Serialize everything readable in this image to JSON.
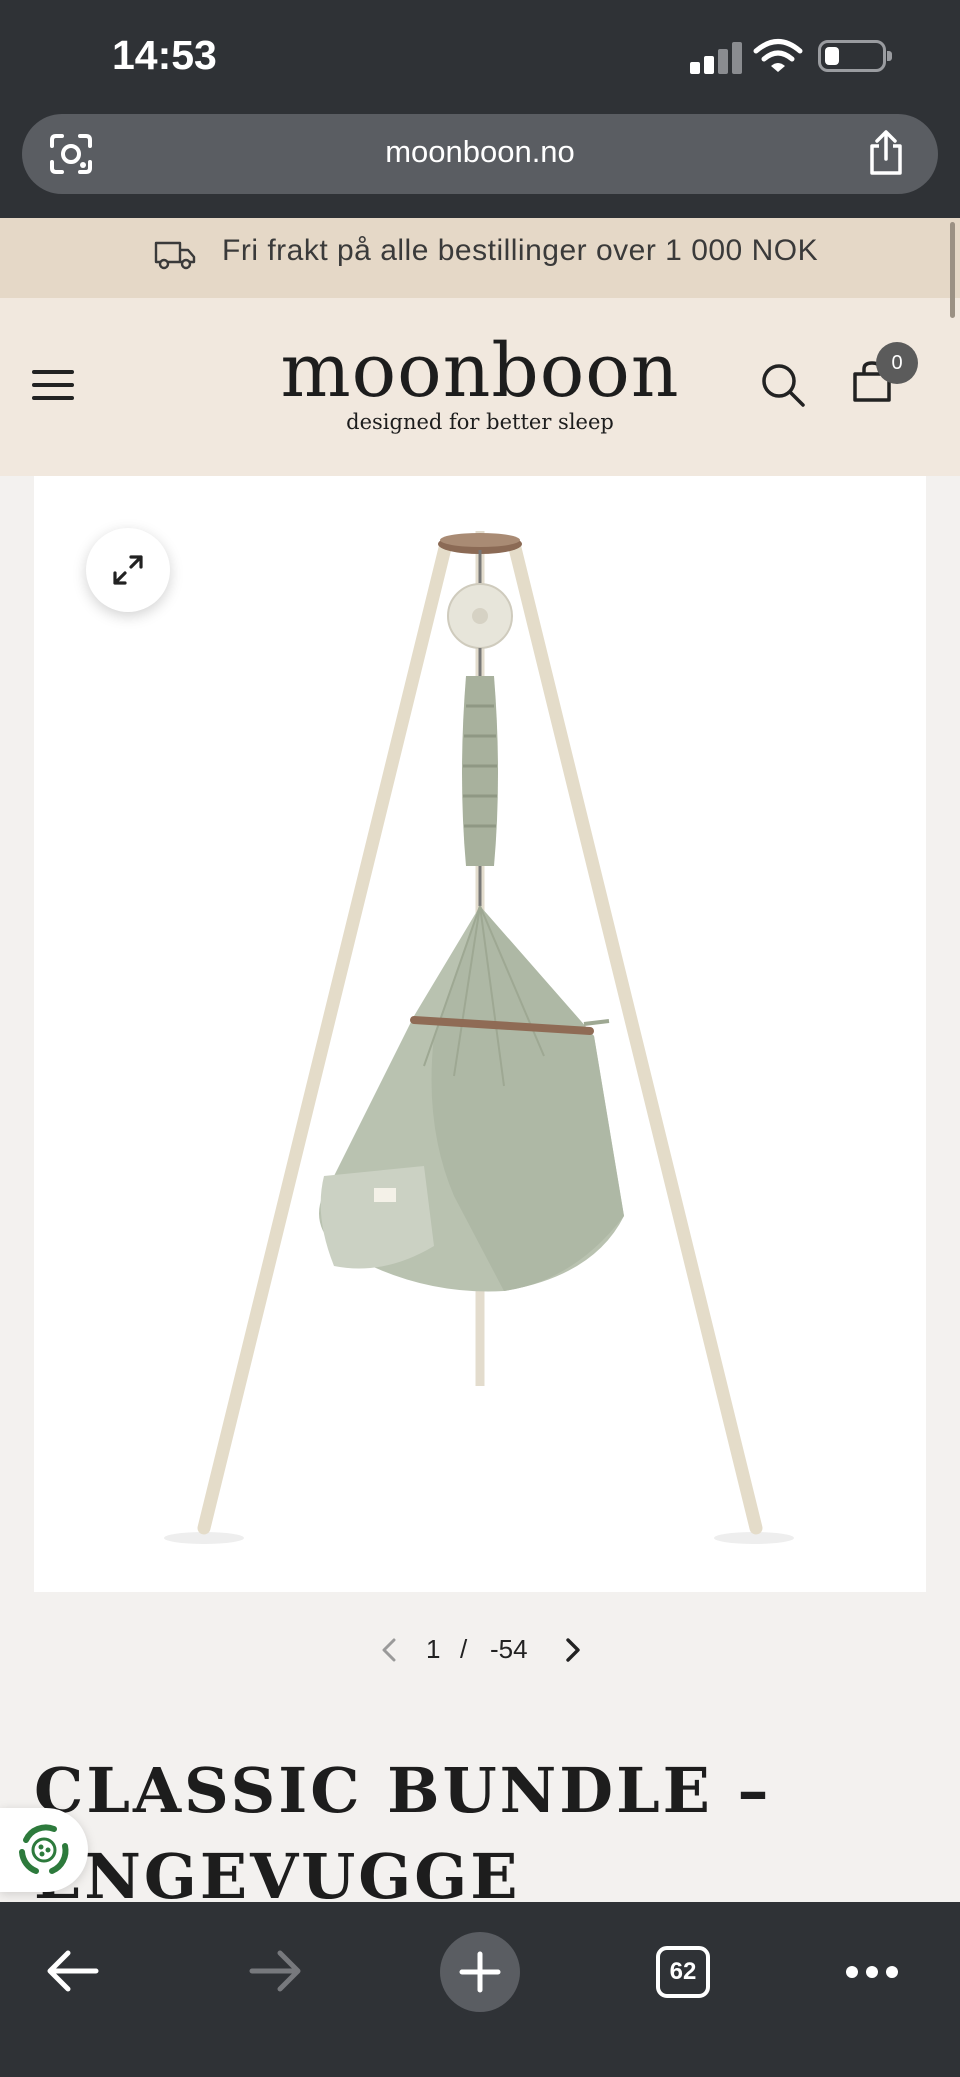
{
  "status_bar": {
    "time": "14:53"
  },
  "browser": {
    "url": "moonboon.no",
    "tab_count": "62"
  },
  "promo": {
    "text": "Fri frakt på alle bestillinger over 1 000 NOK"
  },
  "header": {
    "logo": "moonboon",
    "tagline": "designed for better sleep",
    "cart_count": "0"
  },
  "gallery": {
    "current": "1",
    "separator": "/",
    "total": "-54"
  },
  "product": {
    "title": "CLASSIC BUNDLE – ENGEVUGGE"
  },
  "colors": {
    "chrome": "#2f3236",
    "promo_bg": "#e5d8c7",
    "header_bg": "#f1e8de",
    "page_bg": "#f3f1ef",
    "fabric": "#b9c2b0"
  }
}
